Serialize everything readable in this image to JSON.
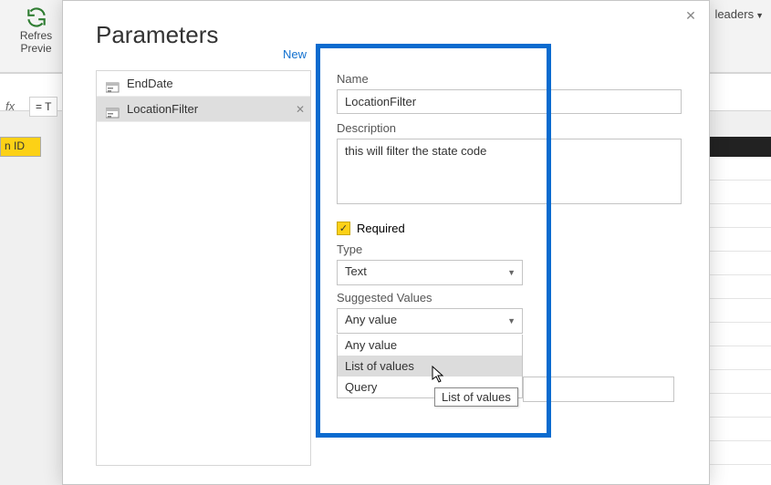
{
  "ribbon": {
    "refresh_label": "Refres",
    "refresh_label2": "Previe",
    "headers_label": "leaders"
  },
  "formula": {
    "fx": "fx",
    "eq": "= T"
  },
  "grid": {
    "col_header": "n ID"
  },
  "dialog": {
    "title": "Parameters",
    "new_link": "New",
    "items": [
      {
        "label": "EndDate"
      },
      {
        "label": "LocationFilter"
      }
    ]
  },
  "form": {
    "name_label": "Name",
    "name_value": "LocationFilter",
    "desc_label": "Description",
    "desc_value": "this will filter the state code",
    "required_label": "Required",
    "type_label": "Type",
    "type_value": "Text",
    "suggested_label": "Suggested Values",
    "suggested_value": "Any value",
    "dropdown": [
      {
        "label": "Any value"
      },
      {
        "label": "List of values"
      },
      {
        "label": "Query"
      }
    ]
  },
  "tooltip": "List of values"
}
